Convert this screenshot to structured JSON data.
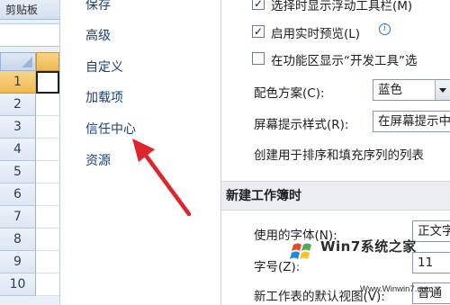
{
  "excel": {
    "clipboard_tab": "剪贴板",
    "row_numbers": [
      "1",
      "2",
      "3",
      "4",
      "5",
      "6",
      "7",
      "8",
      "9",
      "10"
    ]
  },
  "nav": {
    "items": [
      "保存",
      "高级",
      "自定义",
      "加载项",
      "信任中心",
      "资源"
    ]
  },
  "options": {
    "checkbox_floating_toolbar": "选择时显示浮动工具栏(M)",
    "checkbox_live_preview": "启用实时预览(L)",
    "checkbox_developer_tab": "在功能区显示“开发工具”选",
    "color_scheme_label": "配色方案(C):",
    "color_scheme_value": "蓝色",
    "screentip_label": "屏幕提示样式(R):",
    "screentip_value": "在屏幕提示中",
    "custom_list_text": "创建用于排序和填充序列的列表",
    "section_title": "新建工作簿时",
    "font_label": "使用的字体(N):",
    "font_value": "正文字",
    "size_label": "字号(Z):",
    "size_value": "11",
    "view_label": "新工作表的默认视图(V):",
    "view_value": "普通"
  },
  "watermark": {
    "brand_main": "Win7系统之家",
    "brand_url": "Www.Winwin7.com"
  },
  "colors": {
    "arrow": "#e0242b",
    "nav_text": "#1e3f75"
  }
}
